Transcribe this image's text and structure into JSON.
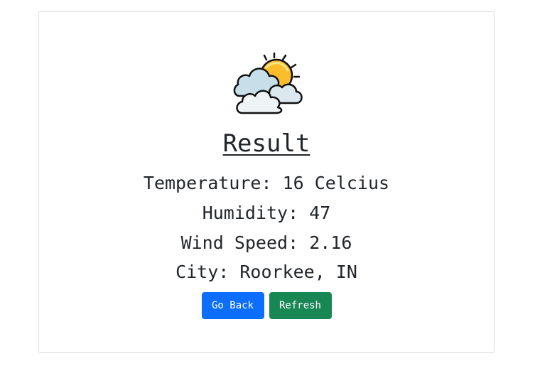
{
  "result": {
    "title": "Result",
    "lines": [
      "Temperature: 16 Celcius",
      "Humidity: 47",
      "Wind Speed: 2.16",
      "City: Roorkee, IN"
    ]
  },
  "buttons": {
    "go_back": "Go Back",
    "refresh": "Refresh"
  },
  "icon": "partly-cloudy-icon",
  "colors": {
    "primary": "#0d6efd",
    "success": "#198754",
    "sun": "#fbbd2c",
    "cloud": "#dbe9ef"
  }
}
